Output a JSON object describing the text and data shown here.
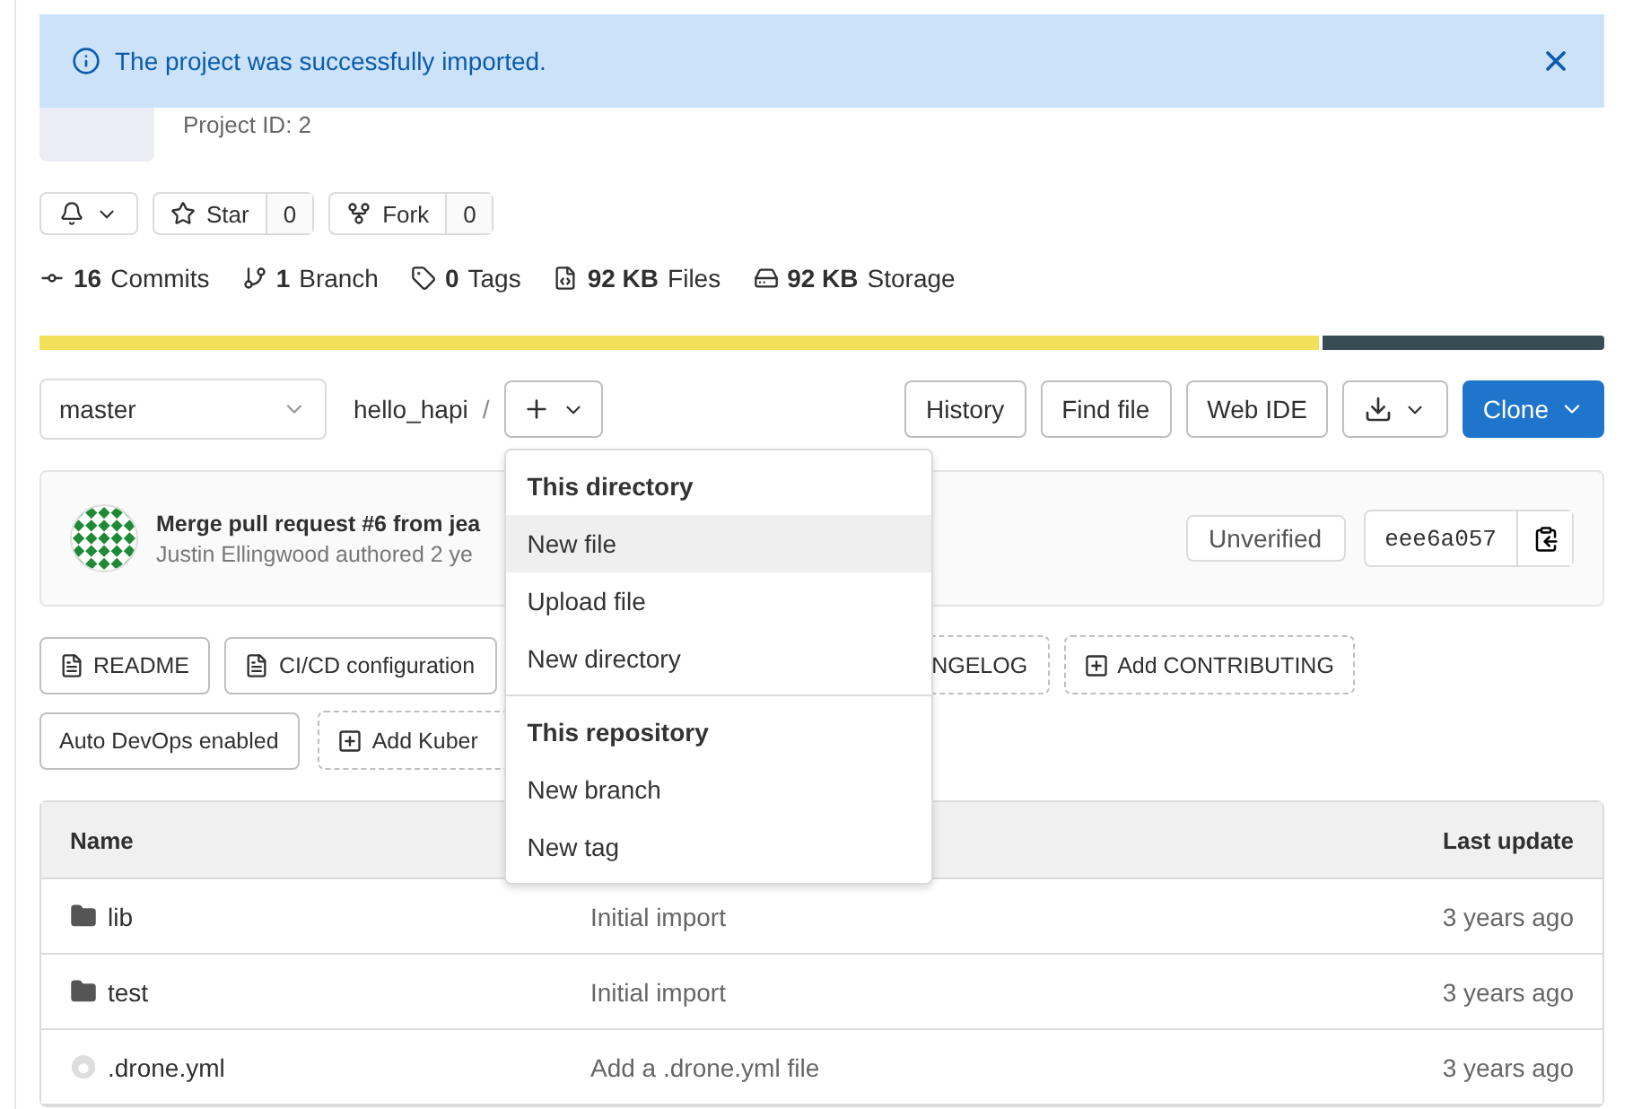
{
  "alert": {
    "message": "The project was successfully imported."
  },
  "project": {
    "id_label": "Project ID: 2"
  },
  "actions": [
    {
      "kind": "notify"
    },
    {
      "kind": "counter",
      "label": "Star",
      "count": "0"
    },
    {
      "kind": "counter",
      "label": "Fork",
      "count": "0"
    }
  ],
  "stats": [
    {
      "kind": "commits",
      "value": "16",
      "label": "Commits"
    },
    {
      "kind": "branch",
      "value": "1",
      "label": "Branch"
    },
    {
      "kind": "tags",
      "value": "0",
      "label": "Tags"
    },
    {
      "kind": "files",
      "value": "92 KB",
      "label": "Files"
    },
    {
      "kind": "storage",
      "value": "92 KB",
      "label": "Storage"
    }
  ],
  "language_bar": {
    "level": 0.82
  },
  "toolbar": {
    "branch": "master",
    "path": "hello_hapi",
    "separator": "/",
    "buttons": [
      "History",
      "Find file",
      "Web IDE"
    ],
    "clone": "Clone"
  },
  "dropdown": {
    "sections": [
      {
        "header": "This directory",
        "items": [
          {
            "label": "New file",
            "selected": true
          },
          {
            "label": "Upload file",
            "selected": false
          },
          {
            "label": "New directory",
            "selected": false
          }
        ]
      },
      {
        "header": "This repository",
        "items": [
          {
            "label": "New branch",
            "selected": false
          },
          {
            "label": "New tag",
            "selected": false
          }
        ]
      }
    ]
  },
  "commit": {
    "title": "Merge pull request #6 from jea",
    "meta": "Justin Ellingwood authored 2 ye",
    "signature": "Unverified",
    "sha": "eee6a057"
  },
  "shortcut_rows": [
    [
      {
        "kind": "file",
        "label": "README"
      },
      {
        "kind": "file",
        "label": "CI/CD configuration"
      },
      {
        "kind": "cut",
        "label": "NGELOG"
      },
      {
        "kind": "add",
        "label": "Add CONTRIBUTING"
      }
    ],
    [
      {
        "kind": "plain",
        "label": "Auto DevOps enabled"
      },
      {
        "kind": "add-cut",
        "label": "Add Kuber"
      }
    ]
  ],
  "table": {
    "columns": [
      "Name",
      "Last update"
    ],
    "rows": [
      {
        "kind": "folder",
        "name": "lib",
        "commit": "Initial import",
        "updated": "3 years ago"
      },
      {
        "kind": "folder",
        "name": "test",
        "commit": "Initial import",
        "updated": "3 years ago"
      },
      {
        "kind": "config",
        "name": ".drone.yml",
        "commit": "Add a .drone.yml file",
        "updated": "3 years ago"
      }
    ]
  }
}
